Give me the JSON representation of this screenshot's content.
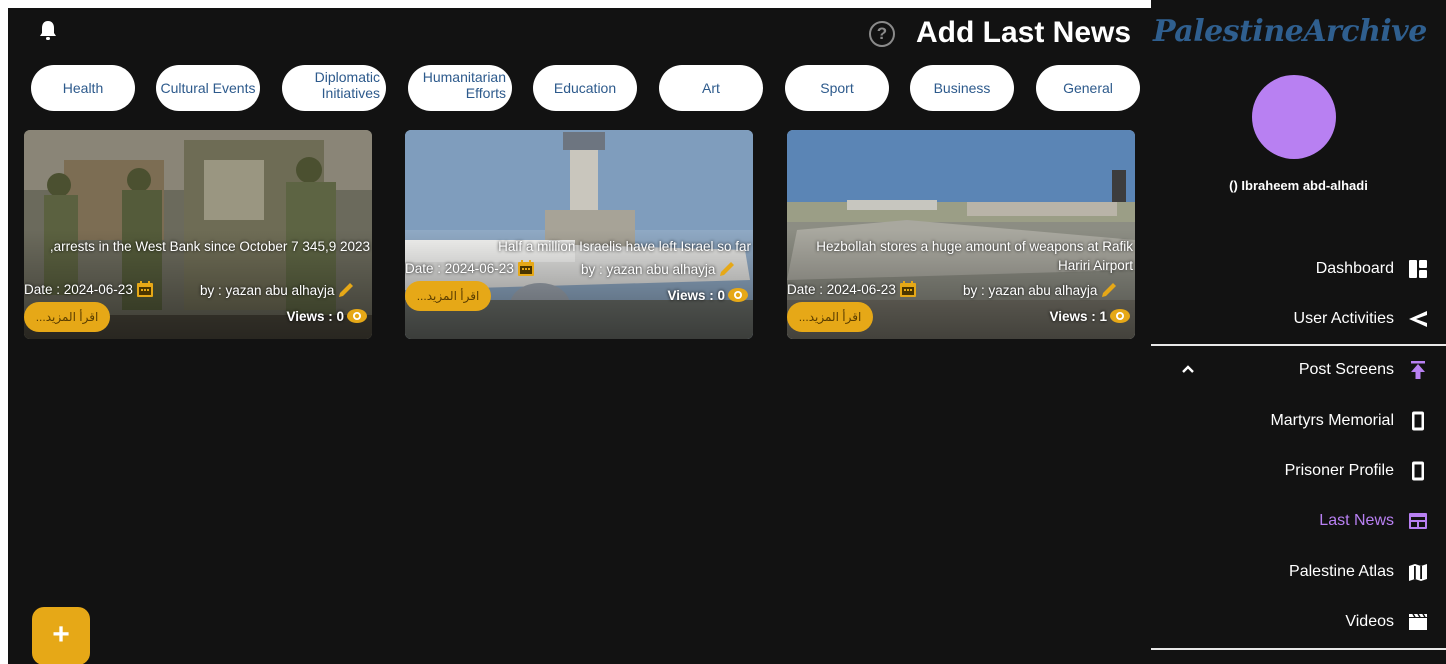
{
  "header": {
    "title": "Add Last News",
    "help_symbol": "?"
  },
  "categories": [
    "Health",
    "Cultural Events",
    "Diplomatic\nInitiatives",
    "Humanitarian\nEfforts",
    "Education",
    "Art",
    "Sport",
    "Business",
    "General"
  ],
  "cards": [
    {
      "title": ",arrests in the West Bank since October 7 345,9 2023",
      "date": "Date : 2024-06-23",
      "author": "by : yazan abu alhayja",
      "views": "Views : 0",
      "more_label": "...اقرأ المزيد"
    },
    {
      "title": "Half a million Israelis have left Israel so far",
      "date": "Date : 2024-06-23",
      "author": "by : yazan abu alhayja",
      "views": "Views : 0",
      "more_label": "...اقرأ المزيد"
    },
    {
      "title": "Hezbollah stores a huge amount of weapons at Rafik Hariri Airport",
      "date": "Date : 2024-06-23",
      "author": "by : yazan abu alhayja",
      "views": "Views : 1",
      "more_label": "...اقرأ المزيد"
    }
  ],
  "fab": {
    "label": "+"
  },
  "sidebar": {
    "logo": "PalestineArchive",
    "username": "() Ibraheem abd-alhadi",
    "items": [
      {
        "label": "Dashboard",
        "icon": "dashboard-icon"
      },
      {
        "label": "User Activities",
        "icon": "send-icon"
      },
      {
        "label": "Post Screens",
        "icon": "upload-icon"
      },
      {
        "label": "Martyrs Memorial",
        "icon": "phone-icon"
      },
      {
        "label": "Prisoner Profile",
        "icon": "phone-icon"
      },
      {
        "label": "Last News",
        "icon": "newspaper-icon",
        "active": true
      },
      {
        "label": "Palestine Atlas",
        "icon": "map-icon"
      },
      {
        "label": "Videos",
        "icon": "clapperboard-icon"
      }
    ]
  },
  "colors": {
    "background": "#121212",
    "accent": "#e6a817",
    "active": "#b880f2",
    "chip_text": "#2d5a8c"
  }
}
